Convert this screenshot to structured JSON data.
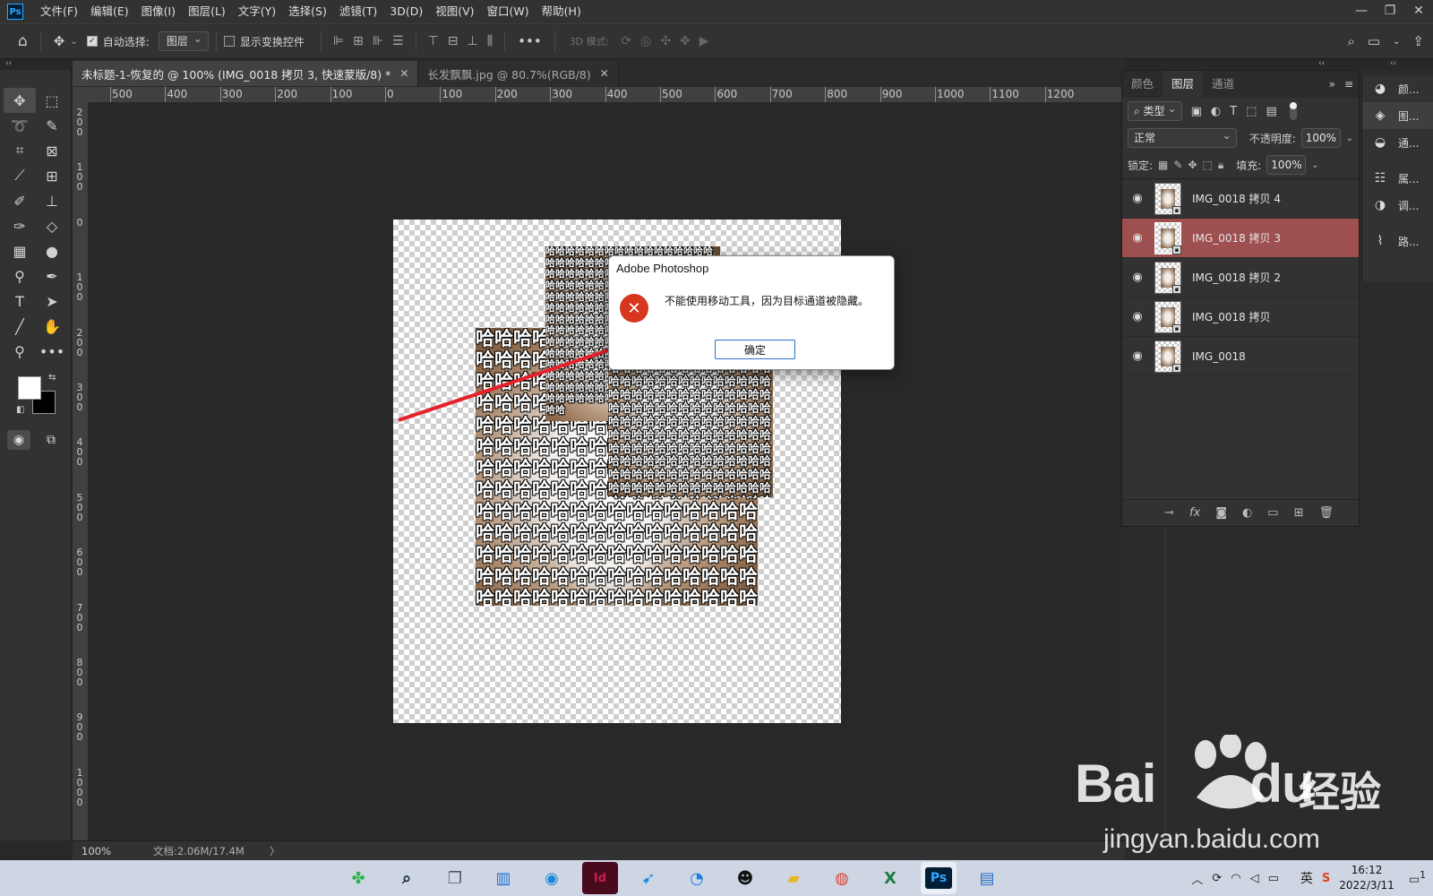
{
  "app": {
    "logo": "Ps",
    "colors": {
      "accent": "#31a8ff",
      "selected_layer": "#9e4f4f",
      "dialog_icon": "#d7371e",
      "arrow": "#e8202a"
    }
  },
  "menu": [
    "文件(F)",
    "编辑(E)",
    "图像(I)",
    "图层(L)",
    "文字(Y)",
    "选择(S)",
    "滤镜(T)",
    "3D(D)",
    "视图(V)",
    "窗口(W)",
    "帮助(H)"
  ],
  "window_controls": [
    "—",
    "❐",
    "✕"
  ],
  "options": {
    "auto_select_label": "自动选择:",
    "auto_select_checked": true,
    "auto_select_target": "图层",
    "show_transform_label": "显示变换控件",
    "show_transform_checked": false,
    "mode_3d_label": "3D 模式:"
  },
  "tabs": [
    {
      "label": "未标题-1-恢复的 @ 100% (IMG_0018 拷贝 3, 快速蒙版/8) *",
      "active": true
    },
    {
      "label": "长发飘飘.jpg @ 80.7%(RGB/8)",
      "active": false
    }
  ],
  "ruler": {
    "h_labels": [
      "500",
      "400",
      "300",
      "200",
      "100",
      "0",
      "100",
      "200",
      "300",
      "400",
      "500",
      "600",
      "700",
      "800",
      "900",
      "1000",
      "1100",
      "1200"
    ],
    "v_labels": [
      "200",
      "100",
      "0",
      "100",
      "200",
      "300",
      "400",
      "500",
      "600",
      "700",
      "800",
      "900",
      "1000"
    ]
  },
  "canvas": {
    "overlay_text": "哈哈哈哈哈哈哈哈哈哈哈哈"
  },
  "dialog": {
    "title": "Adobe Photoshop",
    "message": "不能使用移动工具，因为目标通道被隐藏。",
    "ok_label": "确定"
  },
  "status": {
    "zoom": "100%",
    "doc_info": "文档:2.06M/17.4M",
    "chevron": "〉"
  },
  "layers_panel": {
    "tabs": [
      {
        "label": "颜色",
        "active": false
      },
      {
        "label": "图层",
        "active": true
      },
      {
        "label": "通道",
        "active": false
      }
    ],
    "filter_label": "类型",
    "blend_mode": "正常",
    "opacity_label": "不透明度:",
    "opacity_value": "100%",
    "lock_label": "锁定:",
    "fill_label": "填充:",
    "fill_value": "100%",
    "layers": [
      {
        "name": "IMG_0018 拷贝 4",
        "visible": true,
        "selected": false
      },
      {
        "name": "IMG_0018 拷贝 3",
        "visible": true,
        "selected": true
      },
      {
        "name": "IMG_0018 拷贝 2",
        "visible": true,
        "selected": false
      },
      {
        "name": "IMG_0018 拷贝",
        "visible": true,
        "selected": false
      },
      {
        "name": "IMG_0018",
        "visible": true,
        "selected": false
      }
    ]
  },
  "dock": [
    {
      "label": "颜...",
      "icon": "color-icon",
      "active": false
    },
    {
      "label": "图...",
      "icon": "layers-icon",
      "active": true
    },
    {
      "label": "通...",
      "icon": "channels-icon",
      "active": false
    },
    {
      "label": "属...",
      "icon": "properties-icon",
      "active": false
    },
    {
      "label": "调...",
      "icon": "adjustments-icon",
      "active": false
    },
    {
      "label": "路...",
      "icon": "paths-icon",
      "active": false
    }
  ],
  "taskbar": {
    "ime": "英",
    "time": "16:12",
    "date": "2022/3/11",
    "notification_count": "1"
  },
  "watermark": {
    "brand": "Bai",
    "brand_suffix": "du",
    "cn": "经验",
    "url": "jingyan.baidu.com"
  }
}
